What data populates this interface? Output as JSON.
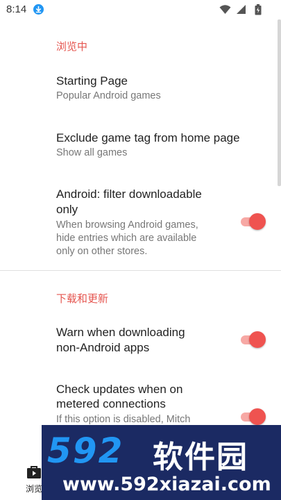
{
  "status_bar": {
    "time": "8:14",
    "icons": [
      "download-icon",
      "wifi-icon",
      "signal-icon",
      "battery-icon"
    ]
  },
  "sections": {
    "browsing": {
      "header": "浏览中",
      "starting_page": {
        "title": "Starting Page",
        "summary": "Popular Android games"
      },
      "exclude_tag": {
        "title": "Exclude game tag from home page",
        "summary": "Show all games"
      },
      "android_filter": {
        "title_line1": "Android: filter downloadable",
        "title_line2": "only",
        "summary_line1": "When browsing Android games,",
        "summary_line2": "hide entries which are available",
        "summary_line3": "only on other stores.",
        "enabled": true
      }
    },
    "downloads": {
      "header": "下载和更新",
      "warn_non_android": {
        "title_line1": "Warn when downloading",
        "title_line2": "non-Android apps",
        "enabled": true
      },
      "metered_updates": {
        "title_line1": "Check updates when on",
        "title_line2": "metered connections",
        "summary_line1": "If this option is disabled, Mitch",
        "enabled": true
      }
    }
  },
  "bottom_nav": {
    "browse_label": "浏览"
  },
  "watermark": {
    "digits": "592",
    "brand": "软件园",
    "url": "www.592xiazai.com"
  },
  "colors": {
    "accent": "#e5554f",
    "switch_thumb": "#ef5350",
    "switch_track": "#f7a8a4",
    "watermark_bg": "#1b2a63"
  }
}
